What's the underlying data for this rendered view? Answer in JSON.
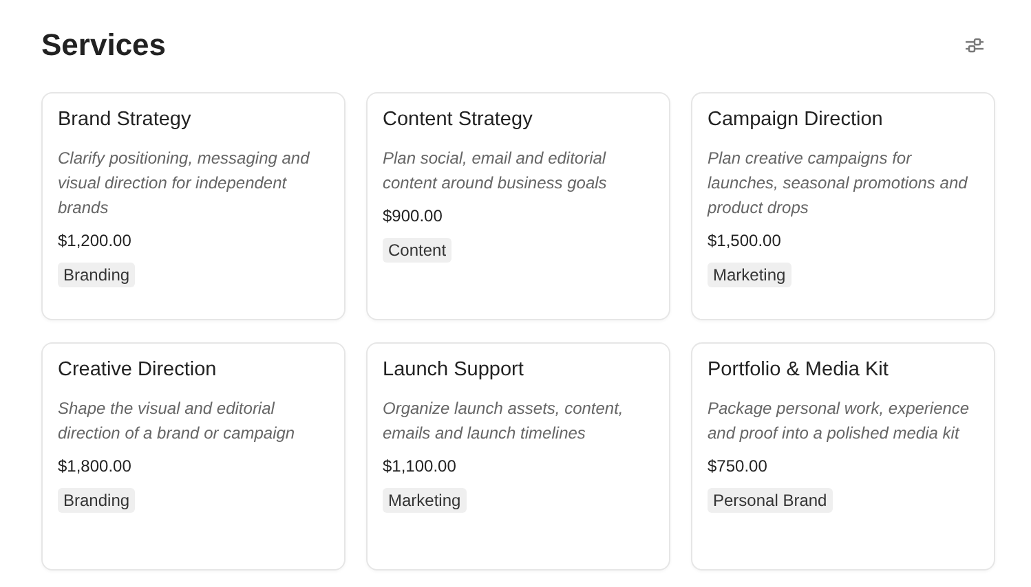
{
  "title": "Services",
  "services": [
    {
      "name": "Brand Strategy",
      "description": "Clarify positioning, messaging and visual direction for independent brands",
      "price": "$1,200.00",
      "tag": "Branding"
    },
    {
      "name": "Content Strategy",
      "description": "Plan social, email and editorial content around business goals",
      "price": "$900.00",
      "tag": "Content"
    },
    {
      "name": "Campaign Direction",
      "description": "Plan creative campaigns for launches, seasonal promotions and product drops",
      "price": "$1,500.00",
      "tag": "Marketing"
    },
    {
      "name": "Creative Direction",
      "description": "Shape the visual and editorial direction of a brand or campaign",
      "price": "$1,800.00",
      "tag": "Branding"
    },
    {
      "name": "Launch Support",
      "description": "Organize launch assets, content, emails and launch timelines",
      "price": "$1,100.00",
      "tag": "Marketing"
    },
    {
      "name": "Portfolio & Media Kit",
      "description": "Package personal work, experience and proof into a polished media kit",
      "price": "$750.00",
      "tag": "Personal Brand"
    }
  ]
}
